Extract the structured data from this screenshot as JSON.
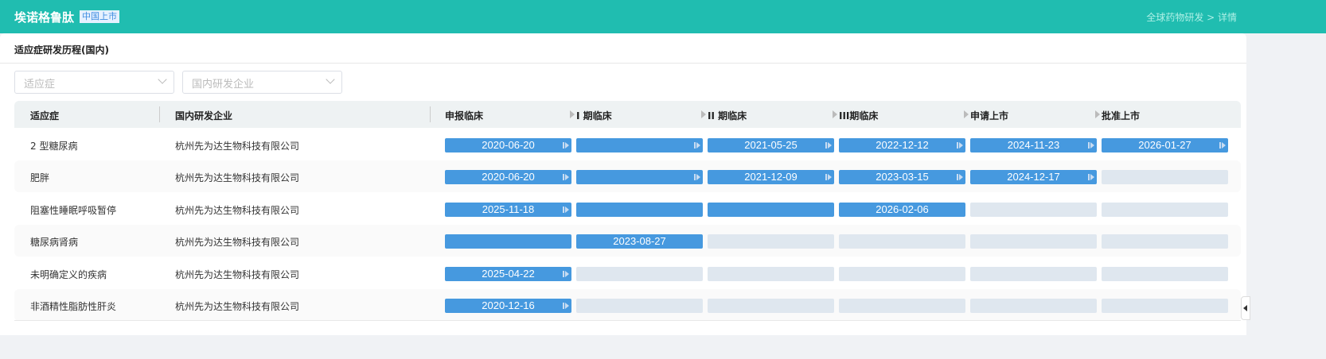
{
  "header": {
    "title": "埃诺格鲁肽",
    "badge": "中国上市",
    "breadcrumb": "全球药物研发 > 详情"
  },
  "section": {
    "title": "适应症研发历程(国内)"
  },
  "filters": {
    "indication_placeholder": "适应症",
    "company_placeholder": "国内研发企业"
  },
  "table": {
    "columns": {
      "indication": "适应症",
      "company": "国内研发企业"
    },
    "stages": [
      "申报临床",
      "I 期临床",
      "II 期临床",
      "III期临床",
      "申请上市",
      "批准上市"
    ],
    "rows": [
      {
        "indication": "2 型糖尿病",
        "company": "杭州先为达生物科技有限公司",
        "cells": [
          {
            "on": true,
            "date": "2020-06-20",
            "arrow": true
          },
          {
            "on": true,
            "date": "",
            "arrow": true
          },
          {
            "on": true,
            "date": "2021-05-25",
            "arrow": true
          },
          {
            "on": true,
            "date": "2022-12-12",
            "arrow": true
          },
          {
            "on": true,
            "date": "2024-11-23",
            "arrow": true
          },
          {
            "on": true,
            "date": "2026-01-27",
            "arrow": true
          }
        ]
      },
      {
        "indication": "肥胖",
        "company": "杭州先为达生物科技有限公司",
        "cells": [
          {
            "on": true,
            "date": "2020-06-20",
            "arrow": true
          },
          {
            "on": true,
            "date": "",
            "arrow": true
          },
          {
            "on": true,
            "date": "2021-12-09",
            "arrow": true
          },
          {
            "on": true,
            "date": "2023-03-15",
            "arrow": true
          },
          {
            "on": true,
            "date": "2024-12-17",
            "arrow": true
          },
          {
            "on": false
          }
        ]
      },
      {
        "indication": "阻塞性睡眠呼吸暂停",
        "company": "杭州先为达生物科技有限公司",
        "cells": [
          {
            "on": true,
            "date": "2025-11-18",
            "arrow": true
          },
          {
            "on": true,
            "date": ""
          },
          {
            "on": true,
            "date": ""
          },
          {
            "on": true,
            "date": "2026-02-06"
          },
          {
            "on": false
          },
          {
            "on": false
          }
        ]
      },
      {
        "indication": "糖尿病肾病",
        "company": "杭州先为达生物科技有限公司",
        "cells": [
          {
            "on": true,
            "date": ""
          },
          {
            "on": true,
            "date": "2023-08-27"
          },
          {
            "on": false
          },
          {
            "on": false
          },
          {
            "on": false
          },
          {
            "on": false
          }
        ]
      },
      {
        "indication": "未明确定义的疾病",
        "company": "杭州先为达生物科技有限公司",
        "cells": [
          {
            "on": true,
            "date": "2025-04-22",
            "arrow": true
          },
          {
            "on": false
          },
          {
            "on": false
          },
          {
            "on": false
          },
          {
            "on": false
          },
          {
            "on": false
          }
        ]
      },
      {
        "indication": "非酒精性脂肪性肝炎",
        "company": "杭州先为达生物科技有限公司",
        "cells": [
          {
            "on": true,
            "date": "2020-12-16",
            "arrow": true
          },
          {
            "on": false
          },
          {
            "on": false
          },
          {
            "on": false
          },
          {
            "on": false
          },
          {
            "on": false
          }
        ]
      }
    ]
  }
}
